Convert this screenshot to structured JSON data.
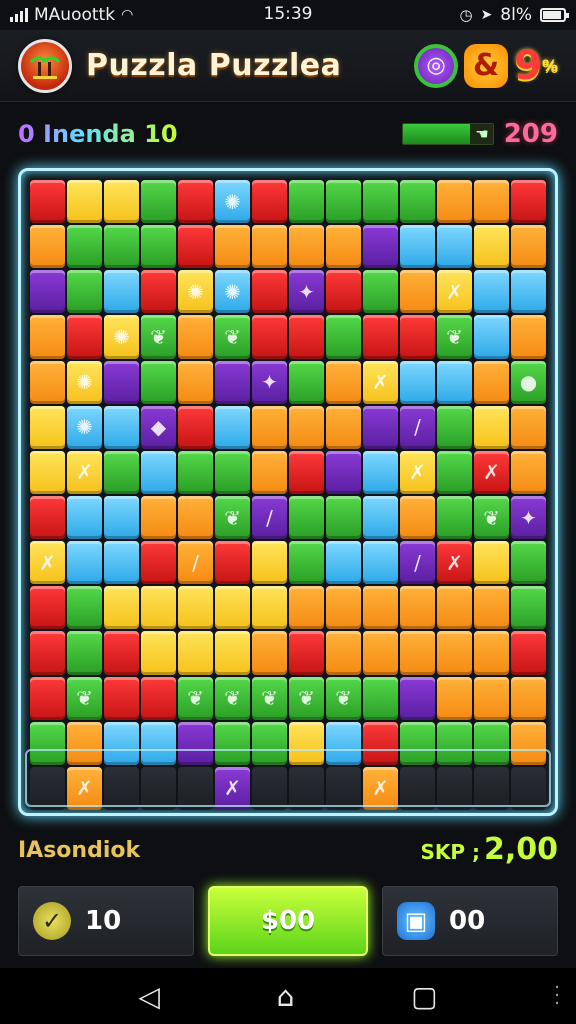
{
  "status_bar": {
    "carrier": "MAuoottk",
    "time": "15:39",
    "battery": "8l%",
    "battery_level": 0.81
  },
  "header": {
    "title": "Puzzla Puzzlea",
    "badge_b": "&",
    "badge_c_main": "9",
    "badge_c_small": "%"
  },
  "info": {
    "level_label": "0 Inenda 10",
    "progress_fraction": 0.75,
    "score": "209"
  },
  "board": {
    "rows": [
      [
        "r",
        "y",
        "y",
        "g",
        "r",
        "b",
        "r",
        "g",
        "g",
        "g",
        "g",
        "o",
        "o",
        "r"
      ],
      [
        "o",
        "g",
        "g",
        "g",
        "r",
        "o",
        "o",
        "o",
        "o",
        "p",
        "b",
        "b",
        "y",
        "o"
      ],
      [
        "p",
        "g",
        "b",
        "r",
        "y",
        "b",
        "r",
        "p",
        "r",
        "g",
        "o",
        "y",
        "b",
        "b"
      ],
      [
        "o",
        "r",
        "y",
        "g",
        "o",
        "g",
        "r",
        "r",
        "g",
        "r",
        "r",
        "g",
        "b",
        "o"
      ],
      [
        "o",
        "y",
        "p",
        "g",
        "o",
        "p",
        "p",
        "g",
        "o",
        "y",
        "b",
        "b",
        "o",
        "g"
      ],
      [
        "y",
        "b",
        "b",
        "p",
        "r",
        "b",
        "o",
        "o",
        "o",
        "p",
        "p",
        "g",
        "y",
        "o"
      ],
      [
        "y",
        "y",
        "g",
        "b",
        "g",
        "g",
        "o",
        "r",
        "p",
        "b",
        "y",
        "g",
        "r",
        "o"
      ],
      [
        "r",
        "b",
        "b",
        "o",
        "o",
        "g",
        "p",
        "g",
        "g",
        "b",
        "o",
        "g",
        "g",
        "p"
      ],
      [
        "y",
        "b",
        "b",
        "r",
        "o",
        "r",
        "y",
        "g",
        "b",
        "b",
        "p",
        "r",
        "y",
        "g"
      ],
      [
        "r",
        "g",
        "y",
        "y",
        "y",
        "y",
        "y",
        "o",
        "o",
        "o",
        "o",
        "o",
        "o",
        "g"
      ],
      [
        "r",
        "g",
        "r",
        "y",
        "y",
        "y",
        "o",
        "r",
        "o",
        "o",
        "o",
        "o",
        "o",
        "r"
      ],
      [
        "r",
        "g",
        "r",
        "r",
        "g",
        "g",
        "g",
        "g",
        "g",
        "g",
        "p",
        "o",
        "o",
        "o"
      ],
      [
        "g",
        "o",
        "b",
        "b",
        "p",
        "g",
        "g",
        "y",
        "b",
        "r",
        "g",
        "g",
        "g",
        "o"
      ],
      [
        "d",
        "o",
        "d",
        "d",
        "d",
        "p",
        "d",
        "d",
        "d",
        "o",
        "d",
        "d",
        "d",
        "d"
      ]
    ],
    "glyphs": {
      "0-5": "✺",
      "2-4": "✺",
      "2-5": "✺",
      "2-7": "✦",
      "2-11": "✗",
      "3-2": "✺",
      "3-3": "❦",
      "3-5": "❦",
      "3-11": "❦",
      "4-1": "✺",
      "4-6": "✦",
      "4-9": "✗",
      "4-13": "●",
      "5-1": "✺",
      "5-3": "◆",
      "5-10": "/",
      "6-1": "✗",
      "6-10": "✗",
      "6-12": "✗",
      "7-5": "❦",
      "7-6": "/",
      "7-12": "❦",
      "7-13": "✦",
      "8-0": "✗",
      "8-4": "/",
      "8-10": "/",
      "8-11": "✗",
      "11-1": "❦",
      "11-4": "❦",
      "11-5": "❦",
      "11-6": "❦",
      "11-7": "❦",
      "11-8": "❦",
      "13-1": "✗",
      "13-5": "✗",
      "13-9": "✗"
    }
  },
  "footer": {
    "label": "IAsondiok",
    "score_prefix": "SKP ;",
    "score_value": "2,00"
  },
  "controls": {
    "left_value": "10",
    "center_label": "$00",
    "right_value": "00"
  },
  "icons": {
    "signal": "signal-icon",
    "wifi": "wifi-icon",
    "battery": "battery-icon",
    "logo": "palm-tree-logo-icon",
    "check": "check-icon",
    "box": "box-icon"
  },
  "colors": {
    "accent": "#5ed8ff",
    "score_pink": "#ff6a9a",
    "footer_green": "#c6ff3a",
    "gold": "#e8c35a"
  }
}
